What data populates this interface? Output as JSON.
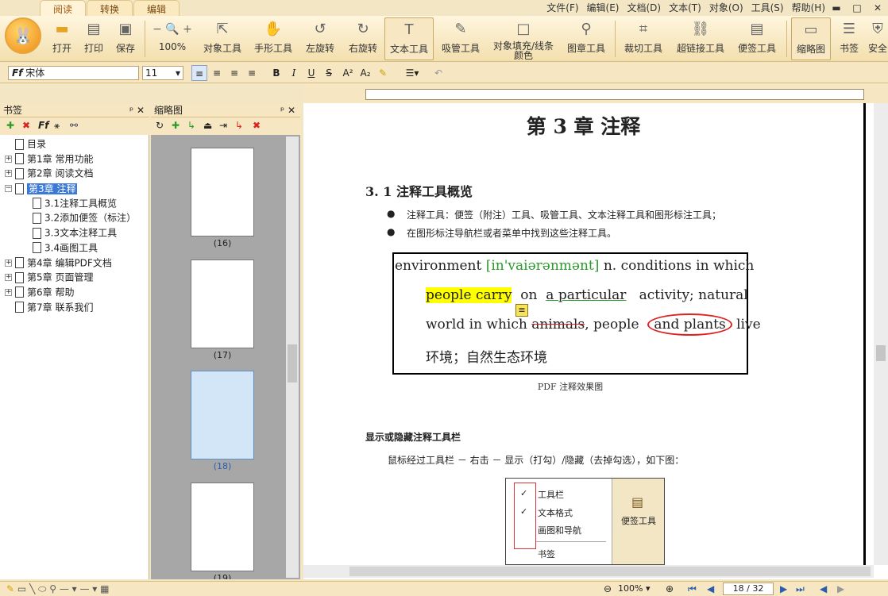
{
  "tabs": [
    "阅读",
    "转换",
    "编辑"
  ],
  "menu": [
    "文件(F)",
    "编辑(E)",
    "文档(D)",
    "文本(T)",
    "对象(O)",
    "工具(S)",
    "帮助(H)"
  ],
  "toolbar": {
    "open": "打开",
    "print": "打印",
    "save": "保存",
    "zoom": "100%",
    "object_tool": "对象工具",
    "hand_tool": "手形工具",
    "rotate_left": "左旋转",
    "rotate_right": "右旋转",
    "text_tool": "文本工具",
    "eyedropper": "吸管工具",
    "fill_line1": "对象填充/线条",
    "fill_line2": "颜色",
    "stamp": "图章工具",
    "crop": "裁切工具",
    "hyperlink": "超链接工具",
    "note": "便签工具",
    "thumbnail": "缩略图",
    "bookmark": "书签",
    "security": "安全"
  },
  "format": {
    "font": "宋体",
    "size": "11"
  },
  "bookmarks": {
    "title": "书签",
    "items": [
      {
        "label": "目录",
        "level": 0
      },
      {
        "label": "第1章 常用功能",
        "level": 0
      },
      {
        "label": "第2章 阅读文档",
        "level": 0
      },
      {
        "label": "第3章 注释",
        "level": 0
      },
      {
        "label": "3.1注释工具概览",
        "level": 1
      },
      {
        "label": "3.2添加便签（标注）",
        "level": 1
      },
      {
        "label": "3.3文本注释工具",
        "level": 1
      },
      {
        "label": "3.4画图工具",
        "level": 1
      },
      {
        "label": "第4章 编辑PDF文档",
        "level": 0
      },
      {
        "label": "第5章 页面管理",
        "level": 0
      },
      {
        "label": "第6章 帮助",
        "level": 0
      },
      {
        "label": "第7章 联系我们",
        "level": 0
      }
    ]
  },
  "thumbnails": {
    "title": "缩略图",
    "pages": [
      "(16)",
      "(17)",
      "(18)",
      "(19)"
    ]
  },
  "document": {
    "chapter": "第 3 章 注释",
    "section": "3. 1 注释工具概览",
    "bullet1": "注释工具：便签（附注）工具、吸管工具、文本注释工具和图形标注工具；",
    "bullet2": "在图形标注导航栏或者菜单中找到这些注释工具。",
    "ex_word": "environment",
    "ex_phon": "[in'vaiərənmənt]",
    "ex_rest1": "n. conditions in which",
    "ex_hl": "people carry",
    "ex_on": "on",
    "ex_ul": "a particular",
    "ex_rest2": "activity; natural",
    "ex_l3a": "world in which",
    "ex_strike": "animals",
    "ex_l3b": ", people",
    "ex_circ": "and plants",
    "ex_live": "live",
    "ex_cn": "环境；自然生态环境",
    "caption": "PDF 注释效果图",
    "subhead": "显示或隐藏注释工具栏",
    "para": "鼠标经过工具栏 － 右击 － 显示（打勾）/隐藏（去掉勾选），如下图：",
    "ctx": [
      "工具栏",
      "文本格式",
      "画图和导航",
      "书签"
    ],
    "ctx_side": "便签工具"
  },
  "status": {
    "zoom": "100%",
    "page": "18 / 32"
  }
}
